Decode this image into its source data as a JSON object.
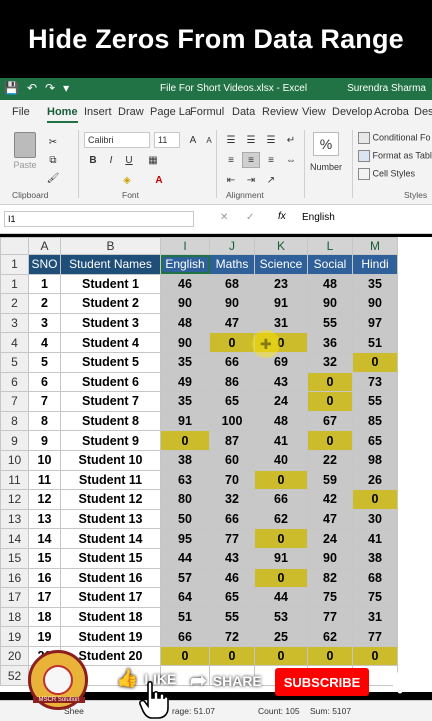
{
  "banner": {
    "title": "Hide Zeros From Data Range"
  },
  "titlebar": {
    "filename": "File For Short Videos.xlsx  -  Excel",
    "user": "Surendra Sharma"
  },
  "tabs": [
    "File",
    "Home",
    "Insert",
    "Draw",
    "Page La",
    "Formul",
    "Data",
    "Review",
    "View",
    "Develop",
    "Acroba",
    "Desi"
  ],
  "ribbon": {
    "paste": "Paste",
    "clipboard": "Clipboard",
    "font_name": "Calibri",
    "font_size": "11",
    "bold": "B",
    "italic": "I",
    "underline": "U",
    "font_group": "Font",
    "alignment_group": "Alignment",
    "number_label": "Number",
    "number_symbol": "%",
    "cond_format": "Conditional Fo",
    "format_table": "Format as Tabl",
    "cell_styles": "Cell Styles",
    "styles_group": "Styles"
  },
  "formula_bar": {
    "name_box": "I1",
    "fx": "fx",
    "content": "English"
  },
  "columns": [
    "A",
    "B",
    "I",
    "J",
    "K",
    "L",
    "M"
  ],
  "headers": [
    "SNO",
    "Student Names",
    "English",
    "Maths",
    "Science",
    "Social",
    "Hindi"
  ],
  "rows": [
    {
      "n": "1",
      "sno": "1",
      "name": "Student 1",
      "v": [
        "46",
        "68",
        "23",
        "48",
        "35"
      ]
    },
    {
      "n": "2",
      "sno": "2",
      "name": "Student 2",
      "v": [
        "90",
        "90",
        "91",
        "90",
        "90"
      ]
    },
    {
      "n": "3",
      "sno": "3",
      "name": "Student 3",
      "v": [
        "48",
        "47",
        "31",
        "55",
        "97"
      ]
    },
    {
      "n": "4",
      "sno": "4",
      "name": "Student 4",
      "v": [
        "90",
        "0",
        "0",
        "36",
        "51"
      ]
    },
    {
      "n": "5",
      "sno": "5",
      "name": "Student 5",
      "v": [
        "35",
        "66",
        "69",
        "32",
        "0"
      ]
    },
    {
      "n": "6",
      "sno": "6",
      "name": "Student 6",
      "v": [
        "49",
        "86",
        "43",
        "0",
        "73"
      ]
    },
    {
      "n": "7",
      "sno": "7",
      "name": "Student 7",
      "v": [
        "35",
        "65",
        "24",
        "0",
        "55"
      ]
    },
    {
      "n": "8",
      "sno": "8",
      "name": "Student 8",
      "v": [
        "91",
        "100",
        "48",
        "67",
        "85"
      ]
    },
    {
      "n": "9",
      "sno": "9",
      "name": "Student 9",
      "v": [
        "0",
        "87",
        "41",
        "0",
        "65"
      ]
    },
    {
      "n": "10",
      "sno": "10",
      "name": "Student 10",
      "v": [
        "38",
        "60",
        "40",
        "22",
        "98"
      ]
    },
    {
      "n": "11",
      "sno": "11",
      "name": "Student 11",
      "v": [
        "63",
        "70",
        "0",
        "59",
        "26"
      ]
    },
    {
      "n": "12",
      "sno": "12",
      "name": "Student 12",
      "v": [
        "80",
        "32",
        "66",
        "42",
        "0"
      ]
    },
    {
      "n": "13",
      "sno": "13",
      "name": "Student 13",
      "v": [
        "50",
        "66",
        "62",
        "47",
        "30"
      ]
    },
    {
      "n": "14",
      "sno": "14",
      "name": "Student 14",
      "v": [
        "95",
        "77",
        "0",
        "24",
        "41"
      ]
    },
    {
      "n": "15",
      "sno": "15",
      "name": "Student 15",
      "v": [
        "44",
        "43",
        "91",
        "90",
        "38"
      ]
    },
    {
      "n": "16",
      "sno": "16",
      "name": "Student 16",
      "v": [
        "57",
        "46",
        "0",
        "82",
        "68"
      ]
    },
    {
      "n": "17",
      "sno": "17",
      "name": "Student 17",
      "v": [
        "64",
        "65",
        "44",
        "75",
        "75"
      ]
    },
    {
      "n": "18",
      "sno": "18",
      "name": "Student 18",
      "v": [
        "51",
        "55",
        "53",
        "77",
        "31"
      ]
    },
    {
      "n": "19",
      "sno": "19",
      "name": "Student 19",
      "v": [
        "66",
        "72",
        "25",
        "62",
        "77"
      ]
    },
    {
      "n": "20",
      "sno": "20",
      "name": "Student 20",
      "v": [
        "0",
        "0",
        "0",
        "0",
        "0"
      ]
    }
  ],
  "header_row_num": "1",
  "extra_row_num": "52",
  "highlight_color": "#ccbb2b",
  "status": {
    "average": "rage: 51.07",
    "count": "Count: 105",
    "sum": "Sum: 5107",
    "sheet": "Shee"
  },
  "overlay": {
    "like": "LIKE",
    "share": "SHARE",
    "subscribe": "SUBSCRIBE",
    "logo_text": "MSCR Solution"
  }
}
